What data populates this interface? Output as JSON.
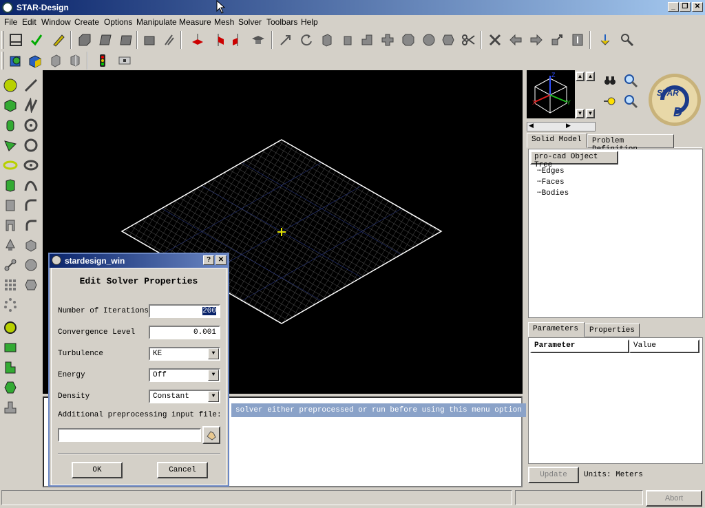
{
  "window": {
    "title": "STAR-Design"
  },
  "menu": [
    "File",
    "Edit",
    "Window",
    "Create",
    "Options",
    "Manipulate",
    "Measure",
    "Mesh",
    "Solver",
    "Toolbars",
    "Help"
  ],
  "colors": {
    "accent": "#0a246a",
    "viewport_bg": "#000000",
    "mesh": "#ffffff",
    "highlight": "#8aa2c8"
  },
  "right_panel": {
    "model_tabs": [
      "Solid Model",
      "Problem Definition"
    ],
    "tree_header": "pro-cad Object Tree",
    "tree_items": [
      "Edges",
      "Faces",
      "Bodies"
    ],
    "bottom_tabs": [
      "Parameters",
      "Properties"
    ],
    "table_headers": [
      "Parameter",
      "Value"
    ],
    "update_label": "Update",
    "units_label": "Units: Meters",
    "logo_text": "STAR CD"
  },
  "console": {
    "message": "solver either preprocessed or run before using this menu option"
  },
  "dialog": {
    "title": "stardesign_win",
    "heading": "Edit Solver Properties",
    "fields": {
      "iterations_label": "Number of Iterations",
      "iterations_value": "200",
      "convergence_label": "Convergence Level",
      "convergence_value": "0.001",
      "turbulence_label": "Turbulence",
      "turbulence_value": "KE",
      "energy_label": "Energy",
      "energy_value": "Off",
      "density_label": "Density",
      "density_value": "Constant",
      "preproc_label": "Additional preprocessing input file:",
      "preproc_value": ""
    },
    "ok_label": "OK",
    "cancel_label": "Cancel",
    "help_glyph": "?",
    "close_glyph": "✕"
  },
  "status": {
    "abort_label": "Abort"
  },
  "window_buttons": {
    "minimize": "_",
    "maximize": "❐",
    "close": "✕"
  }
}
